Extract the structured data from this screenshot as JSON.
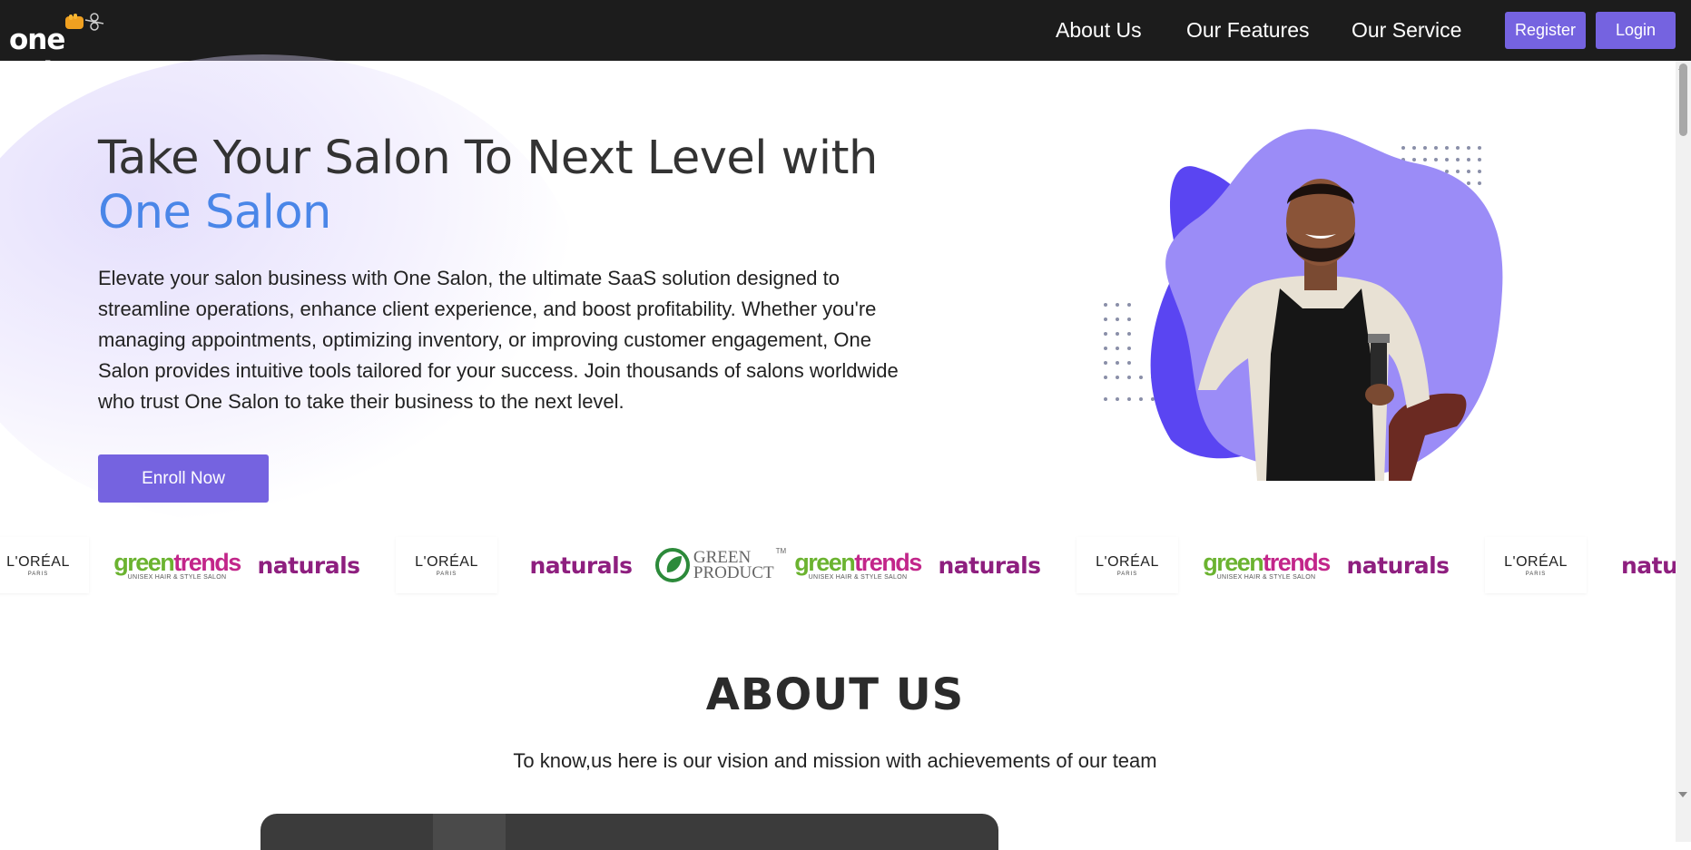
{
  "nav": {
    "logo_text": "one salon",
    "links": [
      "About Us",
      "Our Features",
      "Our Service"
    ],
    "register_label": "Register",
    "login_label": "Login"
  },
  "hero": {
    "title_line1": "Take Your Salon To Next Level with",
    "title_accent": "One Salon",
    "description": "Elevate your salon business with One Salon, the ultimate SaaS solution designed to streamline operations, enhance client experience, and boost profitability. Whether you're managing appointments, optimizing inventory, or improving customer engagement, One Salon provides intuitive tools tailored for your success. Join thousands of salons worldwide who trust One Salon to take their business to the next level.",
    "cta_label": "Enroll Now"
  },
  "brands": {
    "loreal": "L'ORÉAL",
    "loreal_sub": "PARIS",
    "greentrends_green": "green",
    "greentrends_pink": "trends",
    "greentrends_sub": "UNISEX HAIR & STYLE SALON",
    "naturals": "naturals",
    "naturals_partial": "natu",
    "greenproduct_line1": "GREEN",
    "greenproduct_line2": "PRODUCT",
    "greenproduct_tm": "TM"
  },
  "about": {
    "title": "ABOUT US",
    "subtitle": "To know,us here is our vision and mission with achievements of our team"
  },
  "colors": {
    "accent": "#7563e0",
    "title_accent": "#4a86e8",
    "navbar": "#1c1c1c",
    "blob_light": "#9b8cf7",
    "blob_dark": "#5a45f2"
  }
}
